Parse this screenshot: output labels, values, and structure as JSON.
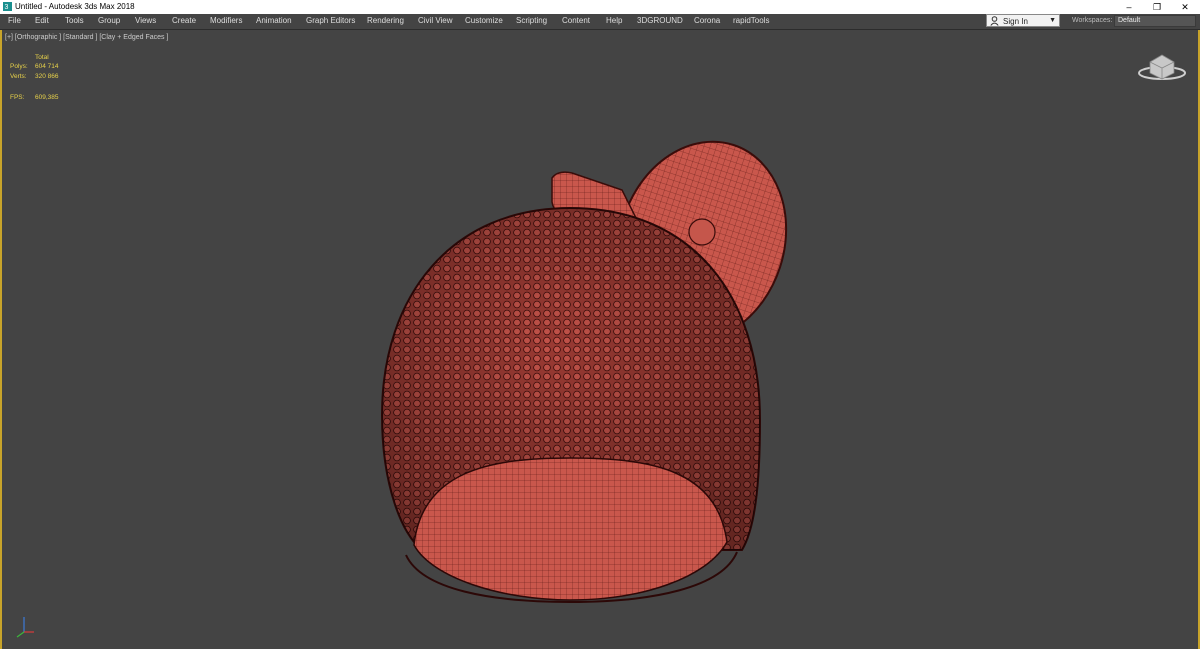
{
  "window": {
    "title": "Untitled - Autodesk 3ds Max 2018",
    "minimize": "–",
    "restore": "❐",
    "close": "✕"
  },
  "menu": {
    "items": [
      "File",
      "Edit",
      "Tools",
      "Group",
      "Views",
      "Create",
      "Modifiers",
      "Animation",
      "Graph Editors",
      "Rendering",
      "Civil View",
      "Customize",
      "Scripting",
      "Content",
      "Help",
      "3DGROUND",
      "Corona",
      "rapidTools"
    ]
  },
  "account": {
    "signin_label": "Sign In",
    "caret": "▼"
  },
  "workspaces": {
    "label": "Workspaces:",
    "value": "Default"
  },
  "viewport": {
    "label": "[+] [Orthographic ] [Standard ] [Clay + Edged Faces ]",
    "stats": {
      "total_label": "Total",
      "polys_label": "Polys:",
      "polys_value": "604 714",
      "verts_label": "Verts:",
      "verts_value": "320 866",
      "fps_label": "FPS:",
      "fps_value": "609,385"
    }
  },
  "colors": {
    "viewport_bg": "#444444",
    "model_fill": "#c05248",
    "wire": "#3a0c0a",
    "stat_text": "#e8d24a",
    "active_border": "#c8a42a"
  }
}
